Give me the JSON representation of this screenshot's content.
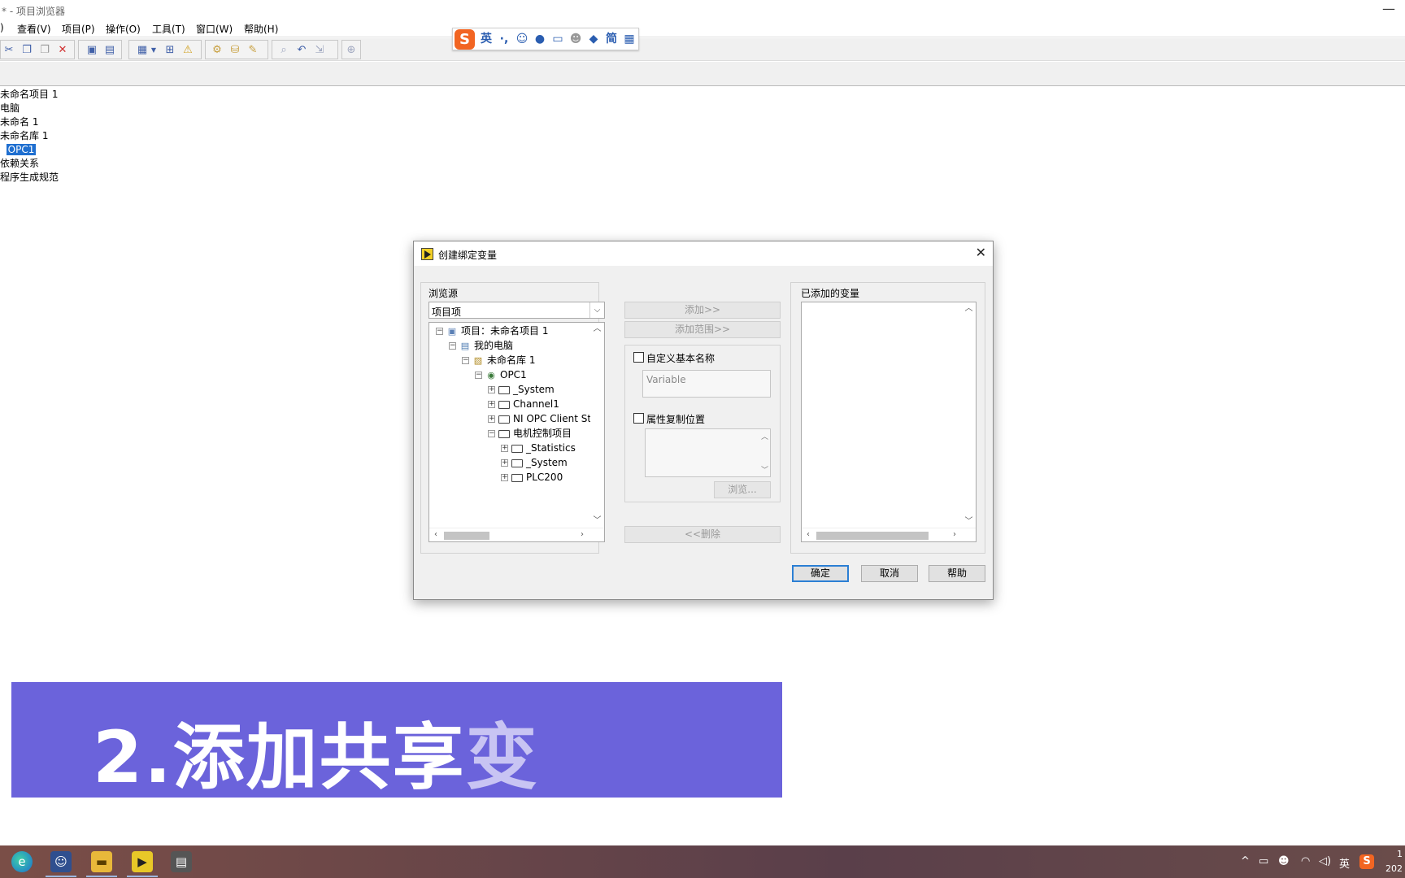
{
  "window": {
    "title": "* - 项目浏览器"
  },
  "menu": [
    "查看(V)",
    "项目(P)",
    "操作(O)",
    "工具(T)",
    "窗口(W)",
    "帮助(H)"
  ],
  "menu_prefix": ")",
  "ime": {
    "lang": "英",
    "punct": "·,",
    "simp": "简"
  },
  "project_tree": [
    "未命名项目 1",
    "电脑",
    "未命名 1",
    "未命名库 1",
    "OPC1",
    "依赖关系",
    "程序生成规范"
  ],
  "dialog": {
    "title": "创建绑定变量",
    "browse_source_label": "浏览源",
    "browse_source_value": "项目项",
    "tree": [
      {
        "label": "项目：未命名项目 1",
        "icon": "project-icon",
        "exp": "⊟"
      },
      {
        "label": "我的电脑",
        "icon": "computer-icon",
        "exp": "⊟"
      },
      {
        "label": "未命名库 1",
        "icon": "library-icon",
        "exp": "⊟"
      },
      {
        "label": "OPC1",
        "icon": "opc-server-icon",
        "exp": "⊟"
      },
      {
        "label": "_System",
        "icon": "folder-icon",
        "exp": "⊞"
      },
      {
        "label": "Channel1",
        "icon": "folder-icon",
        "exp": "⊞"
      },
      {
        "label": "NI OPC Client St",
        "icon": "folder-icon",
        "exp": "⊞"
      },
      {
        "label": "电机控制项目",
        "icon": "folder-icon",
        "exp": "⊟"
      },
      {
        "label": "_Statistics",
        "icon": "folder-icon",
        "exp": "⊞"
      },
      {
        "label": "_System",
        "icon": "folder-icon",
        "exp": "⊞"
      },
      {
        "label": "PLC200",
        "icon": "folder-icon",
        "exp": "⊞"
      }
    ],
    "add_button": "添加>>",
    "add_range_button": "添加范围>>",
    "custom_base_name_label": "自定义基本名称",
    "custom_base_name_placeholder": "Variable",
    "copy_property_location_label": "属性复制位置",
    "browse_button": "浏览...",
    "remove_button": "<<删除",
    "added_variables_label": "已添加的变量",
    "ok_button": "确定",
    "cancel_button": "取消",
    "help_button": "帮助"
  },
  "banner": {
    "text_main": "2.添加共享",
    "text_fade": "变"
  },
  "tray": {
    "lang": "英",
    "time_partial": "1",
    "date_partial": "202"
  },
  "colors": {
    "banner_bg": "#6b63db",
    "selection": "#1f6fd0",
    "default_button_border": "#2b7fd4"
  }
}
